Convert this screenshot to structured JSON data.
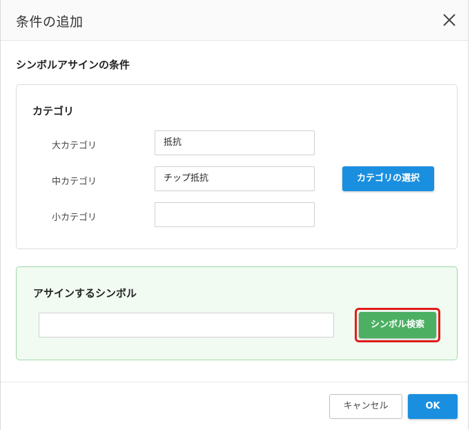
{
  "dialog": {
    "title": "条件の追加",
    "close_icon": "close-icon"
  },
  "section": {
    "title": "シンボルアサインの条件"
  },
  "category": {
    "title": "カテゴリ",
    "rows": [
      {
        "label": "大カテゴリ",
        "value": "抵抗"
      },
      {
        "label": "中カテゴリ",
        "value": "チップ抵抗"
      },
      {
        "label": "小カテゴリ",
        "value": ""
      }
    ],
    "select_button": "カテゴリの選択"
  },
  "assign": {
    "title": "アサインするシンボル",
    "value": "",
    "search_button": "シンボル検索"
  },
  "footer": {
    "cancel_label": "キャンセル",
    "ok_label": "OK"
  },
  "colors": {
    "primary": "#1a8fe0",
    "success": "#4caf62",
    "highlight": "#e01a1a",
    "assign_bg": "#f1fbf2"
  }
}
